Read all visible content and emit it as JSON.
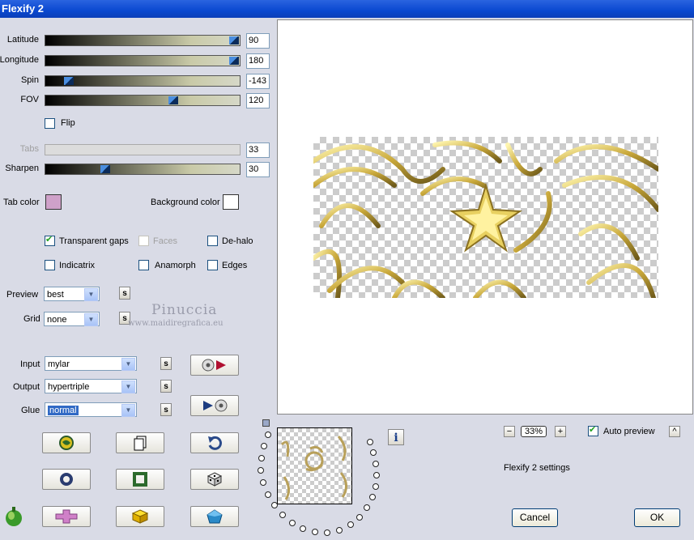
{
  "window": {
    "title": "Flexify 2"
  },
  "sliders": [
    {
      "label": "Latitude",
      "value": "90",
      "level": 0.97
    },
    {
      "label": "Longitude",
      "value": "180",
      "level": 0.97
    },
    {
      "label": "Spin",
      "value": "-143",
      "level": 0.12
    },
    {
      "label": "FOV",
      "value": "120",
      "level": 0.66
    },
    {
      "label": "Tabs",
      "value": "33",
      "disabled": true
    },
    {
      "label": "Sharpen",
      "value": "30",
      "level": 0.31
    }
  ],
  "flip": {
    "label": "Flip",
    "checked": false
  },
  "colors": {
    "tab_label": "Tab color",
    "tab_color": "#cfa1c9",
    "bg_label": "Background color",
    "bg_color": "#ffffff"
  },
  "options": {
    "transparent_gaps": "Transparent gaps",
    "faces": "Faces",
    "de_halo": "De-halo",
    "indicatrix": "Indicatrix",
    "anamorph": "Anamorph",
    "edges": "Edges"
  },
  "preview_select": {
    "label": "Preview",
    "value": "best"
  },
  "grid_select": {
    "label": "Grid",
    "value": "none"
  },
  "input_select": {
    "label": "Input",
    "value": "mylar"
  },
  "output_select": {
    "label": "Output",
    "value": "hypertriple"
  },
  "glue_select": {
    "label": "Glue",
    "value": "normal"
  },
  "s_label": "s",
  "watermark": {
    "name": "Pinuccia",
    "site": "www.maidiregrafica.eu"
  },
  "zoom": {
    "minus": "−",
    "value": "33%",
    "plus": "+"
  },
  "auto_preview": {
    "label": "Auto preview",
    "checked": true
  },
  "caret": "^",
  "info": "i",
  "settings_text": "Flexify 2 settings",
  "buttons": {
    "cancel": "Cancel",
    "ok": "OK"
  }
}
